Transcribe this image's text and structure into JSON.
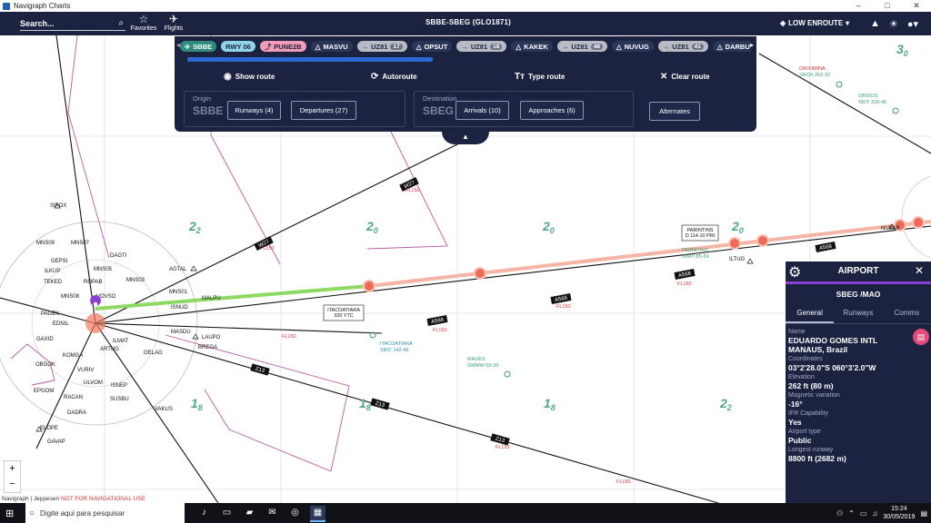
{
  "window": {
    "title": "Navigraph Charts"
  },
  "topbar": {
    "search_placeholder": "Search...",
    "favorites_label": "Favorites",
    "flights_label": "Flights",
    "route_title": "SBBE-SBEG (GLO1871)",
    "layer_label": "LOW ENROUTE"
  },
  "route": {
    "chips": [
      {
        "label": "SBBE",
        "kind": "apt",
        "icon": "✈"
      },
      {
        "label": "RWY 06",
        "kind": "rwy",
        "icon": ""
      },
      {
        "label": "PUNE2B",
        "kind": "sid",
        "icon": "⤴"
      },
      {
        "label": "MASVU",
        "kind": "wpt",
        "icon": "△"
      },
      {
        "label": "UZ81",
        "kind": "airway",
        "icon": "→",
        "count": "17"
      },
      {
        "label": "OPSUT",
        "kind": "wpt",
        "icon": "△"
      },
      {
        "label": "UZ81",
        "kind": "airway",
        "icon": "→",
        "count": "18"
      },
      {
        "label": "KAKEK",
        "kind": "wpt",
        "icon": "△"
      },
      {
        "label": "UZ81",
        "kind": "airway",
        "icon": "→",
        "count": "48"
      },
      {
        "label": "NUVUG",
        "kind": "wpt",
        "icon": "△"
      },
      {
        "label": "UZ81",
        "kind": "airway",
        "icon": "→",
        "count": "41"
      },
      {
        "label": "DARBU",
        "kind": "wpt",
        "icon": "△"
      }
    ],
    "actions": {
      "show_route": "Show route",
      "autoroute": "Autoroute",
      "type_route": "Type route",
      "clear_route": "Clear route"
    },
    "origin": {
      "label": "Origin",
      "code": "SBBE",
      "runways": "Runways (4)",
      "departures": "Departures (27)"
    },
    "destination": {
      "label": "Destination",
      "code": "SBEG",
      "arrivals": "Arrivals (10)",
      "approaches": "Approaches (6)"
    },
    "alternates": "Alternates"
  },
  "airport_panel": {
    "title": "AIRPORT",
    "code": "SBEG /MAO",
    "tabs": [
      "General",
      "Runways",
      "Comms"
    ],
    "fields": [
      {
        "label": "Name",
        "value": "EDUARDO GOMES INTL\nMANAUS, Brazil"
      },
      {
        "label": "Coordinates",
        "value": "03°2'28.0\"S  060°3'2.0\"W"
      },
      {
        "label": "Elevation",
        "value": "262 ft (80 m)"
      },
      {
        "label": "Magnetic variation",
        "value": "-16°"
      },
      {
        "label": "IFR Capability",
        "value": "Yes"
      },
      {
        "label": "Airport type",
        "value": "Public"
      },
      {
        "label": "Longest runway",
        "value": "8800 ft (2682 m)"
      }
    ]
  },
  "map": {
    "attribution": "Navigraph | Jeppesen",
    "warning": "NOT FOR NAVIGATIONAL USE",
    "zoom_in": "+",
    "zoom_out": "−",
    "labels": {
      "itacoatiara_box": "ITACOATIARA\n320 YTC",
      "itacoatiara": "ITACOATIARA",
      "itacoatiara_code": "SBIC 142-49",
      "parintins_box": "PARINTINS\nD 114.10 PRI",
      "parintins": "PARINTINS",
      "parintins_code": "SWPI 85-59",
      "maues": "MAUES",
      "maues_code": "SWMW 69-39",
      "oriximina": "ORIXIMINA",
      "oriximina_code": "SNOX 262-32",
      "obidos": "OBIDOS",
      "obidos_code": "SNTI 328-45",
      "iltug": "ILTUG",
      "nupar": "NUPAR",
      "malpu": "MALPU",
      "laupo": "LAUPO",
      "brega": "BREGA",
      "gelag": "GELAG",
      "masdu": "MASDU",
      "isnud": "ISNUD",
      "agtal": "AGTAL",
      "vakus": "VAKUS",
      "mns01": "MNS01",
      "mns03": "MNS03",
      "mns05": "MNS05",
      "mns07": "MNS07",
      "mns08": "MNS08",
      "mns09": "MNS09",
      "dagti": "DAGTI",
      "vovso": "VOVSO",
      "ropab": "ROPAB",
      "gepsi": "GEPSI",
      "ilkup": "ILKUP",
      "teked": "TEKED",
      "pagek": "PAGEK",
      "ednil": "EDNIL",
      "gaxid": "GAXID",
      "ilmat": "ILMAT",
      "artug": "ARTUG",
      "komga": "KOMGA",
      "obgok": "OBGOK",
      "vuriv": "VURIV",
      "ulvom": "ULVOM",
      "isnep": "ISNEP",
      "epgom": "EPGOM",
      "racan": "RACAN",
      "susbu": "SUSBU",
      "dadra": "DADRA",
      "elope": "ELOPE",
      "gavap": "GAVAP",
      "sipox": "SIPOX",
      "a566": "A566",
      "w27": "W27",
      "z13": "Z13",
      "fl150": "FL150",
      "mora_2_2": "2",
      "mora_2_0": "2",
      "mora_1_8": "1",
      "mora_3_0": "3",
      "sub_2": "2",
      "sub_0": "0",
      "sub_8": "8"
    }
  },
  "taskbar": {
    "search_placeholder": "Digite aqui para pesquisar",
    "time": "15:24",
    "date": "30/05/2019"
  }
}
